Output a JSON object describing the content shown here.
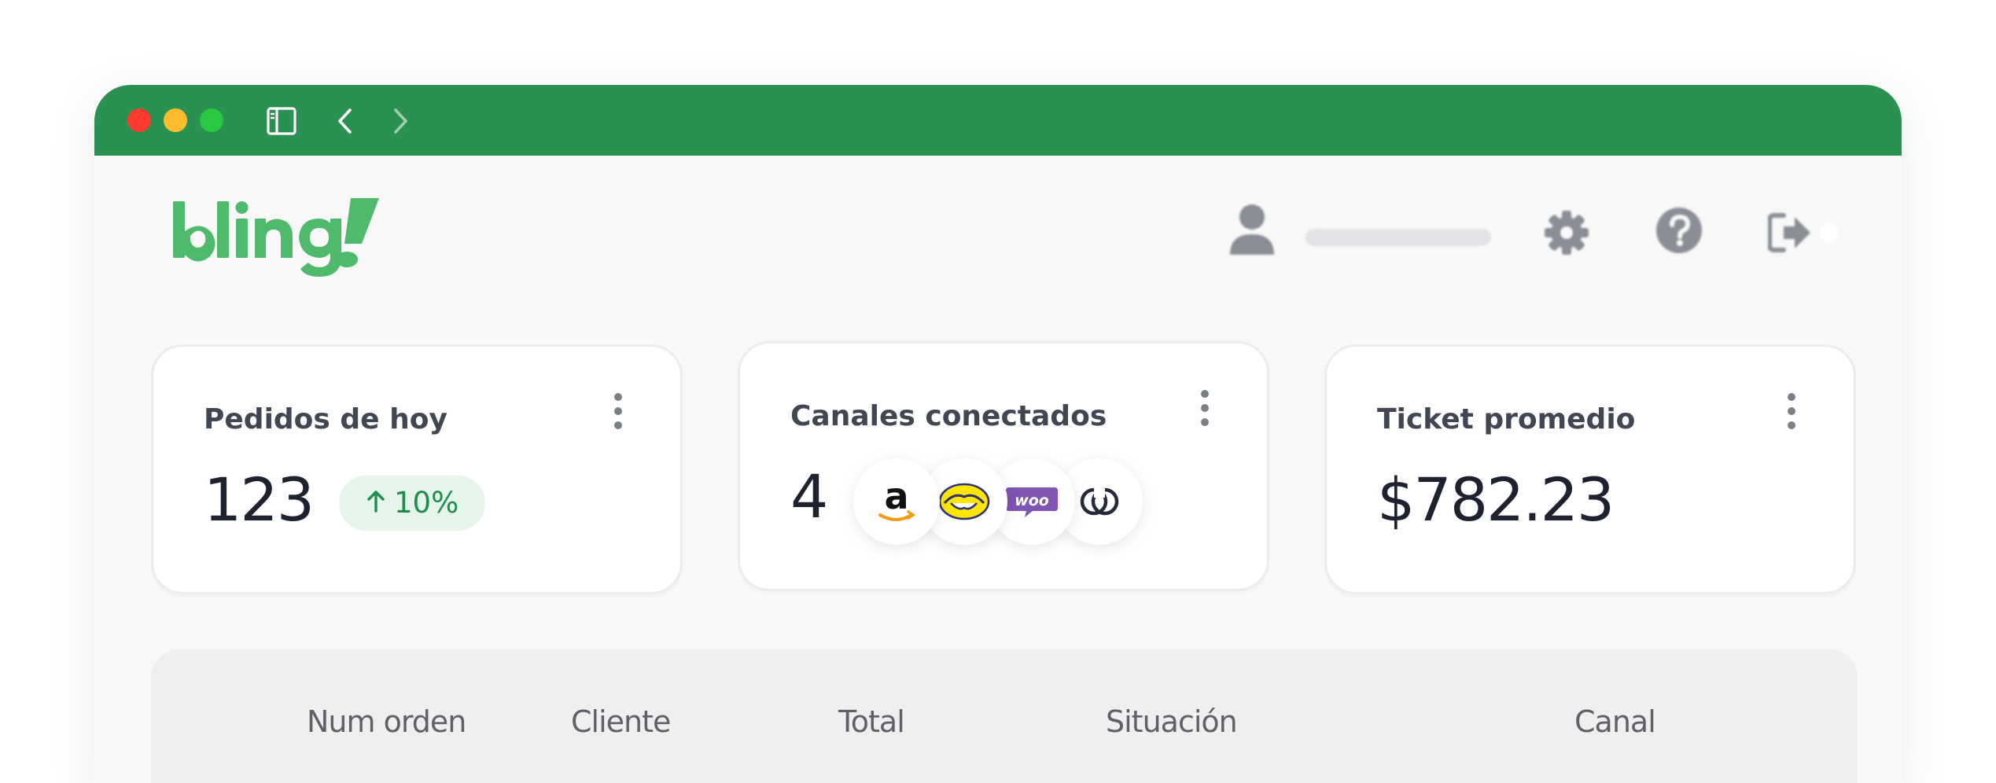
{
  "window": {
    "controls": [
      "close",
      "minimize",
      "maximize"
    ]
  },
  "toolbar": {
    "icons": [
      "sidebar-toggle-icon",
      "back-chevron-icon",
      "forward-chevron-icon"
    ]
  },
  "brand": {
    "logo_text": "bling!",
    "color": "#4fb96c"
  },
  "colors": {
    "titlebar": "#2a9152",
    "badge_bg": "#e5f5ea",
    "badge_text": "#1f8d4c"
  },
  "header": {
    "icons": [
      "user-icon",
      "gear-icon",
      "help-icon",
      "logout-icon"
    ]
  },
  "cards": [
    {
      "title": "Pedidos de hoy",
      "value": "123",
      "badge": {
        "icon": "arrow-up-icon",
        "text": "10%"
      }
    },
    {
      "title": "Canales conectados",
      "value": "4",
      "channels": [
        "amazon",
        "mercado-libre",
        "woocommerce",
        "shopify-like"
      ]
    },
    {
      "title": "Ticket promedio",
      "value": "$782.23"
    }
  ],
  "table": {
    "columns": [
      "Num orden",
      "Cliente",
      "Total",
      "Situación",
      "Canal"
    ]
  }
}
